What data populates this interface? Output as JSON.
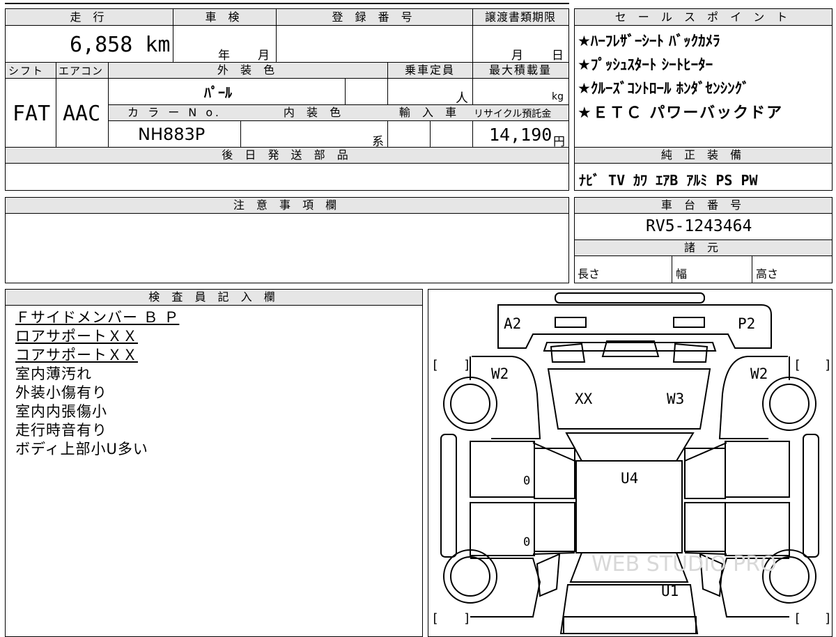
{
  "header": {
    "mileage_label": "走 行",
    "mileage_value": "6,858 km",
    "shaken_label": "車 検",
    "shaken_year": "年",
    "shaken_month": "月",
    "registration_label": "登 録 番 号",
    "transfer_label": "譲渡書類期限",
    "transfer_month": "月",
    "transfer_day": "日"
  },
  "spec": {
    "shift_label": "シフト",
    "shift_value": "FAT",
    "ac_label": "エアコン",
    "ac_value": "AAC",
    "exterior_color_label": "外 装 色",
    "exterior_color_value": "ﾊﾟｰﾙ",
    "capacity_label": "乗車定員",
    "capacity_unit": "人",
    "max_load_label": "最大積載量",
    "max_load_unit": "kg",
    "color_no_label": "カ ラ ー N o.",
    "color_no_value": "NH883P",
    "interior_color_label": "内 装 色",
    "interior_suffix": "系",
    "import_label": "輸 入 車",
    "recycle_label": "リサイクル預託金",
    "recycle_value": "14,190",
    "recycle_unit": "円"
  },
  "sales_points": {
    "label": "セ ー ル ス ポ イ ン ト",
    "items": [
      "★ﾊｰﾌﾚｻﾞｰｼｰﾄ ﾊﾞｯｸｶﾒﾗ",
      "★ﾌﾟｯｼｭｽﾀｰﾄ ｼｰﾄﾋｰﾀｰ",
      "★ｸﾙｰｽﾞｺﾝﾄﾛｰﾙ ﾎﾝﾀﾞｾﾝｼﾝｸﾞ",
      "★ＥＴＣ パワーバックドア"
    ]
  },
  "later_parts": {
    "label": "後 日 発 送 部 品"
  },
  "genuine_equipment": {
    "label": "純 正 装 備",
    "value": "ﾅﾋﾞ TV ｶﾜ ｴｱB ｱﾙﾐ PS PW"
  },
  "notes": {
    "label": "注 意 事 項 欄"
  },
  "chassis": {
    "label": "車 台 番 号",
    "value": "RV5-1243464"
  },
  "dimensions": {
    "label": "諸 元",
    "length": "長さ",
    "width": "幅",
    "height": "高さ"
  },
  "inspector": {
    "label": "検 査 員 記 入 欄",
    "lines": [
      {
        "text": "Ｆサイドメンバー Ｂ Ｐ",
        "underline": true
      },
      {
        "text": "ロアサポートＸＸ",
        "underline": true
      },
      {
        "text": "コアサポートＸＸ",
        "underline": true
      },
      {
        "text": "室内薄汚れ",
        "underline": false
      },
      {
        "text": "外装小傷有り",
        "underline": false
      },
      {
        "text": "室内内張傷小",
        "underline": false
      },
      {
        "text": "走行時音有り",
        "underline": false
      },
      {
        "text": "ボディ上部小U多い",
        "underline": false
      }
    ]
  },
  "diagram": {
    "marks": {
      "front_left": "A2",
      "front_right": "P2",
      "left_fender": "W2",
      "right_fender": "W2",
      "hood_left": "XX",
      "hood_right": "W3",
      "left_front_door": "0",
      "left_rear_door": "0",
      "roof": "U4",
      "rear": "U1"
    },
    "watermark": "WEB STUDIO PRO"
  }
}
